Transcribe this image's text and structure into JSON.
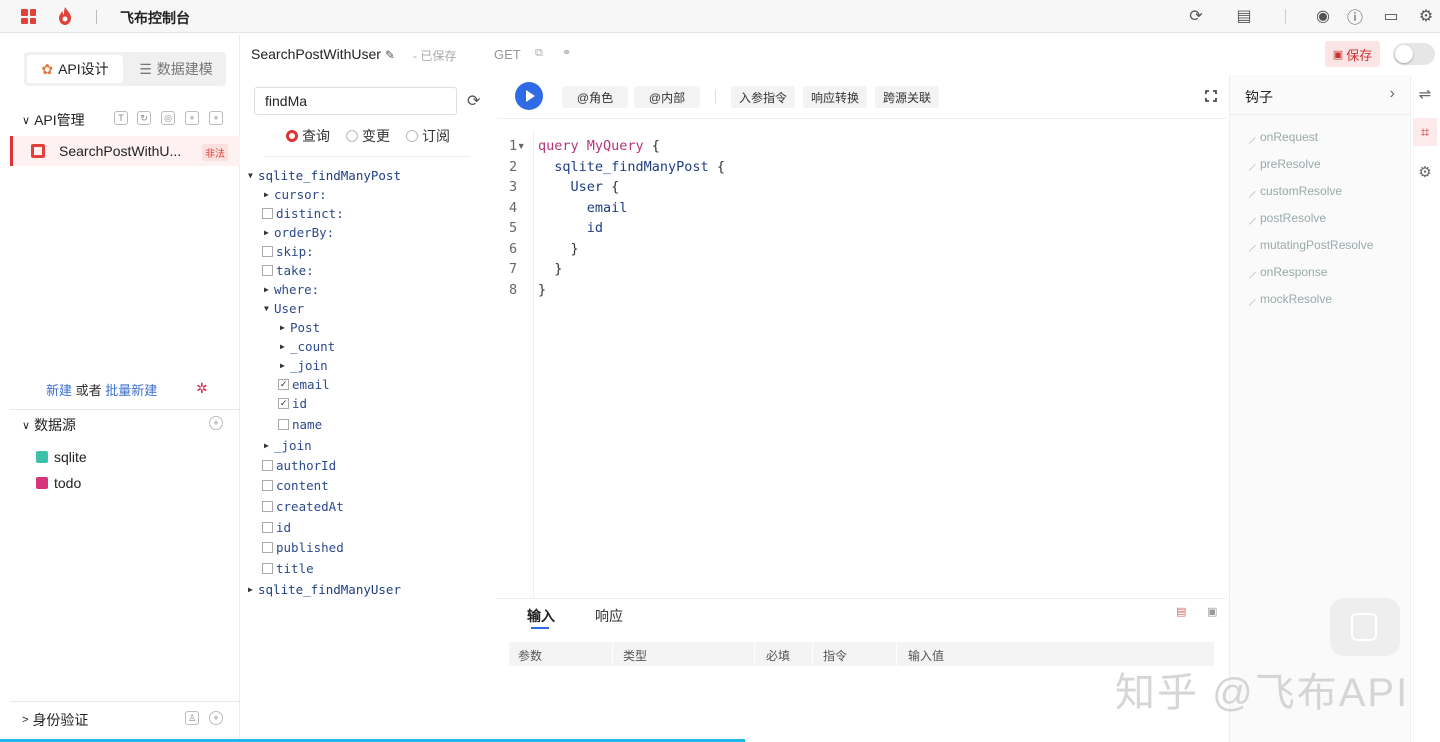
{
  "topbar": {
    "title": "飞布控制台",
    "icons": [
      "refresh-icon",
      "document-icon",
      "github-icon",
      "help-icon",
      "message-icon",
      "settings-icon"
    ]
  },
  "left": {
    "tabs": {
      "api_design": "API设计",
      "data_model": "数据建模"
    },
    "api_section": "API管理",
    "api_item": {
      "name": "SearchPostWithU...",
      "tag": "非法"
    },
    "new_link": {
      "new": "新建",
      "or": "或者",
      "batch": "批量新建"
    },
    "datasource_section": "数据源",
    "datasources": [
      {
        "name": "sqlite",
        "color": "#3cc1a8"
      },
      {
        "name": "todo",
        "color": "#d6347a"
      }
    ],
    "auth_section": "身份验证"
  },
  "header": {
    "api_name": "SearchPostWithUser",
    "saved": "- 已保存",
    "method": "GET",
    "save_label": "保存"
  },
  "explorer": {
    "search_value": "findMa",
    "ops": [
      "查询",
      "变更",
      "订阅"
    ],
    "tree": [
      {
        "label": "sqlite_findManyPost",
        "arrow": "▼",
        "type": "root"
      },
      {
        "label": "cursor:",
        "arrow": "▶",
        "type": "arg"
      },
      {
        "label": "distinct:",
        "check": "",
        "type": "arg"
      },
      {
        "label": "orderBy:",
        "arrow": "▶",
        "type": "arg"
      },
      {
        "label": "skip:",
        "check": "",
        "type": "arg"
      },
      {
        "label": "take:",
        "check": "",
        "type": "arg"
      },
      {
        "label": "where:",
        "arrow": "▶",
        "type": "arg"
      },
      {
        "label": "User",
        "arrow": "▼",
        "type": "field"
      },
      {
        "label": "Post",
        "arrow": "▶",
        "type": "sub"
      },
      {
        "label": "_count",
        "arrow": "▶",
        "type": "sub"
      },
      {
        "label": "_join",
        "arrow": "▶",
        "type": "sub"
      },
      {
        "label": "email",
        "check": "✓",
        "type": "sub"
      },
      {
        "label": "id",
        "check": "✓",
        "type": "sub"
      },
      {
        "label": "name",
        "check": "",
        "type": "sub"
      },
      {
        "label": "_join",
        "arrow": "▶",
        "type": "field"
      },
      {
        "label": "authorId",
        "check": "",
        "type": "field"
      },
      {
        "label": "content",
        "check": "",
        "type": "field"
      },
      {
        "label": "createdAt",
        "check": "",
        "type": "field"
      },
      {
        "label": "id",
        "check": "",
        "type": "field"
      },
      {
        "label": "published",
        "check": "",
        "type": "field"
      },
      {
        "label": "title",
        "check": "",
        "type": "field"
      },
      {
        "label": "sqlite_findManyUser",
        "arrow": "▶",
        "type": "root"
      }
    ]
  },
  "toolbar": {
    "role": "@角色",
    "internal": "@内部",
    "input_directive": "入参指令",
    "response_transform": "响应转换",
    "cross_source": "跨源关联"
  },
  "editor": {
    "lines": [
      {
        "n": "1",
        "fold": "▾",
        "code": [
          [
            "kw",
            "query MyQuery"
          ],
          [
            "",
            " {"
          ]
        ]
      },
      {
        "n": "2",
        "code": [
          [
            "fld",
            "  sqlite_findManyPost"
          ],
          [
            "",
            " {"
          ]
        ]
      },
      {
        "n": "3",
        "code": [
          [
            "fld",
            "    User"
          ],
          [
            "",
            " {"
          ]
        ]
      },
      {
        "n": "4",
        "code": [
          [
            "fld",
            "      email"
          ]
        ]
      },
      {
        "n": "5",
        "code": [
          [
            "fld",
            "      id"
          ]
        ]
      },
      {
        "n": "6",
        "code": [
          [
            "",
            "    }"
          ]
        ]
      },
      {
        "n": "7",
        "code": [
          [
            "",
            "  }"
          ]
        ]
      },
      {
        "n": "8",
        "code": [
          [
            "",
            "}"
          ]
        ]
      }
    ]
  },
  "results": {
    "tabs": [
      "输入",
      "响应"
    ],
    "columns": [
      "参数",
      "类型",
      "必填",
      "指令",
      "输入值"
    ]
  },
  "hooks": {
    "title": "钩子",
    "items": [
      "onRequest",
      "preResolve",
      "customResolve",
      "postResolve",
      "mutatingPostResolve",
      "onResponse",
      "mockResolve"
    ]
  },
  "watermark": "知乎 @飞布API"
}
